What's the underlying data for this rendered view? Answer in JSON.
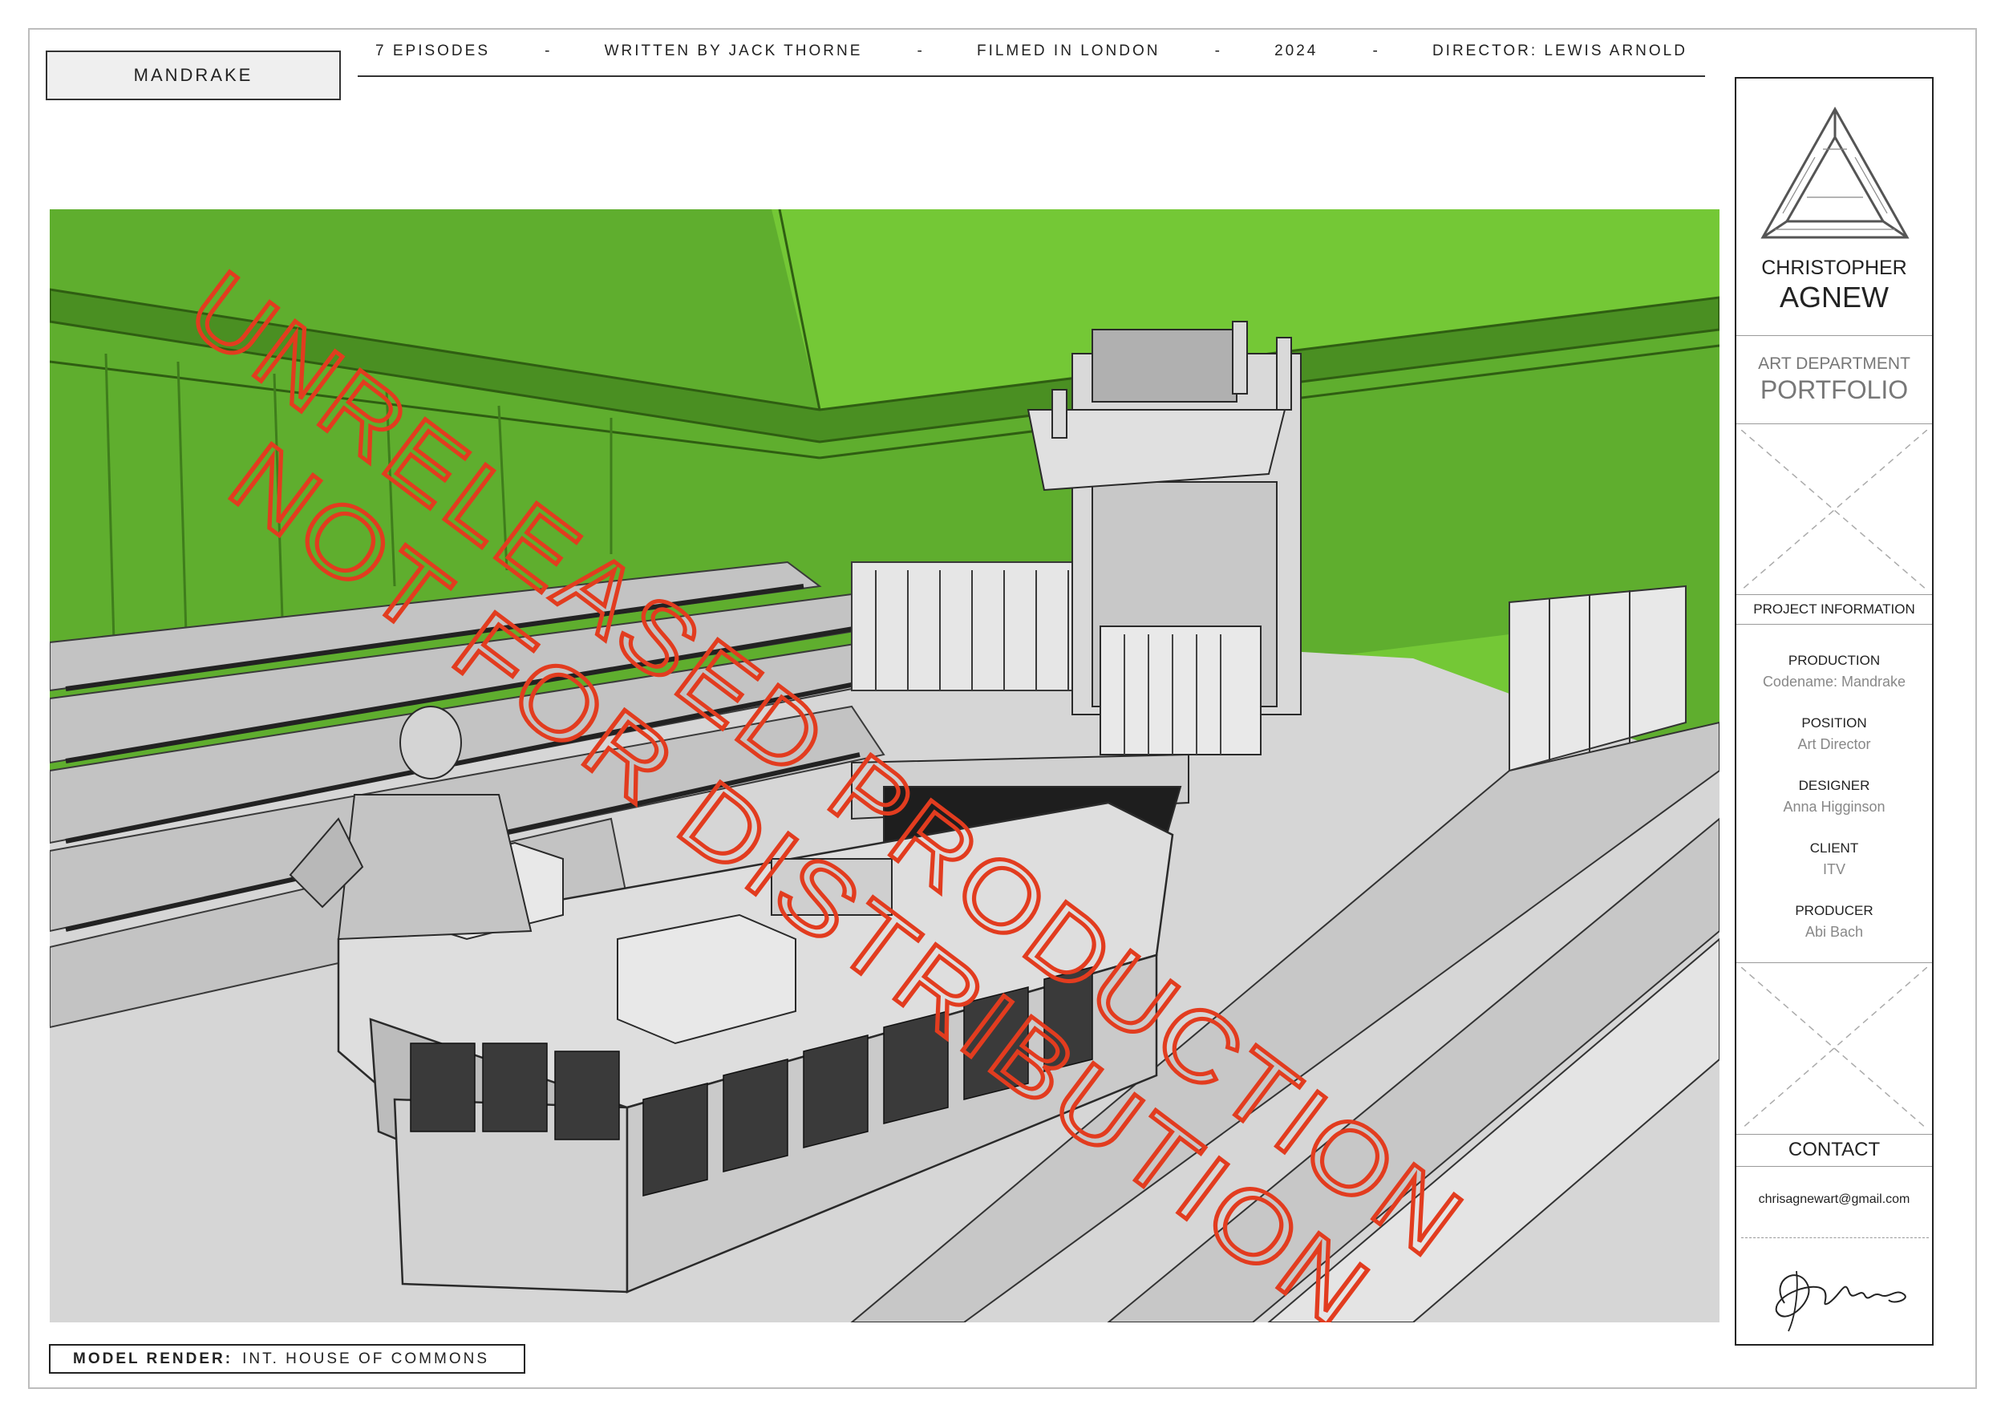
{
  "header": {
    "project_title": "MANDRAKE",
    "credits": [
      "7 EPISODES",
      "WRITTEN BY JACK THORNE",
      "FILMED IN LONDON",
      "2024",
      "DIRECTOR: LEWIS ARNOLD"
    ],
    "separator": "-"
  },
  "render": {
    "watermark_line1": "UNRELEASED PRODUCTION",
    "watermark_line2": "NOT FOR DISTRIBUTION",
    "caption_label": "MODEL RENDER:",
    "caption_text": "INT. HOUSE OF COMMONS",
    "colors": {
      "backdrop_green": "#5fae2e",
      "bright_green": "#74c836",
      "watermark_red": "#e23c1f"
    }
  },
  "panel": {
    "name_first": "CHRISTOPHER",
    "name_last": "AGNEW",
    "department": "ART DEPARTMENT",
    "portfolio": "PORTFOLIO",
    "project_info_heading": "PROJECT INFORMATION",
    "fields": [
      {
        "label": "PRODUCTION",
        "value": "Codename: Mandrake"
      },
      {
        "label": "POSITION",
        "value": "Art Director"
      },
      {
        "label": "DESIGNER",
        "value": "Anna Higginson"
      },
      {
        "label": "CLIENT",
        "value": "ITV"
      },
      {
        "label": "PRODUCER",
        "value": "Abi Bach"
      }
    ],
    "contact_heading": "CONTACT",
    "email": "chrisagnewart@gmail.com",
    "icons": [
      "impossible-triangle-logo-icon",
      "image-placeholder-icon",
      "signature-icon"
    ]
  }
}
